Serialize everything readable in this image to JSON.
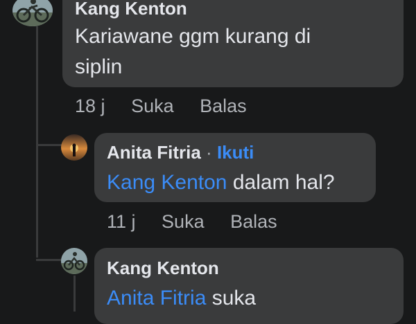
{
  "comments": [
    {
      "author": "Kang Kenton",
      "lines": [
        "Kariawane ggm kurang di",
        "siplin"
      ],
      "time": "18 j",
      "like": "Suka",
      "reply": "Balas"
    },
    {
      "author": "Anita Fitria",
      "separator": "·",
      "follow": "Ikuti",
      "mention": "Kang Kenton",
      "text": "dalam hal?",
      "time": "11 j",
      "like": "Suka",
      "reply": "Balas"
    },
    {
      "author": "Kang Kenton",
      "mention": "Anita Fitria",
      "text": "suka"
    }
  ],
  "colors": {
    "background": "#18191a",
    "bubble": "#3a3b3c",
    "text": "#e4e6eb",
    "meta": "#b0b3b8",
    "link": "#3b8cf7"
  },
  "icons": {
    "kang_kenton_avatar": "motorcycle-photo-avatar",
    "anita_fitria_avatar": "sunset-silhouette-avatar"
  }
}
